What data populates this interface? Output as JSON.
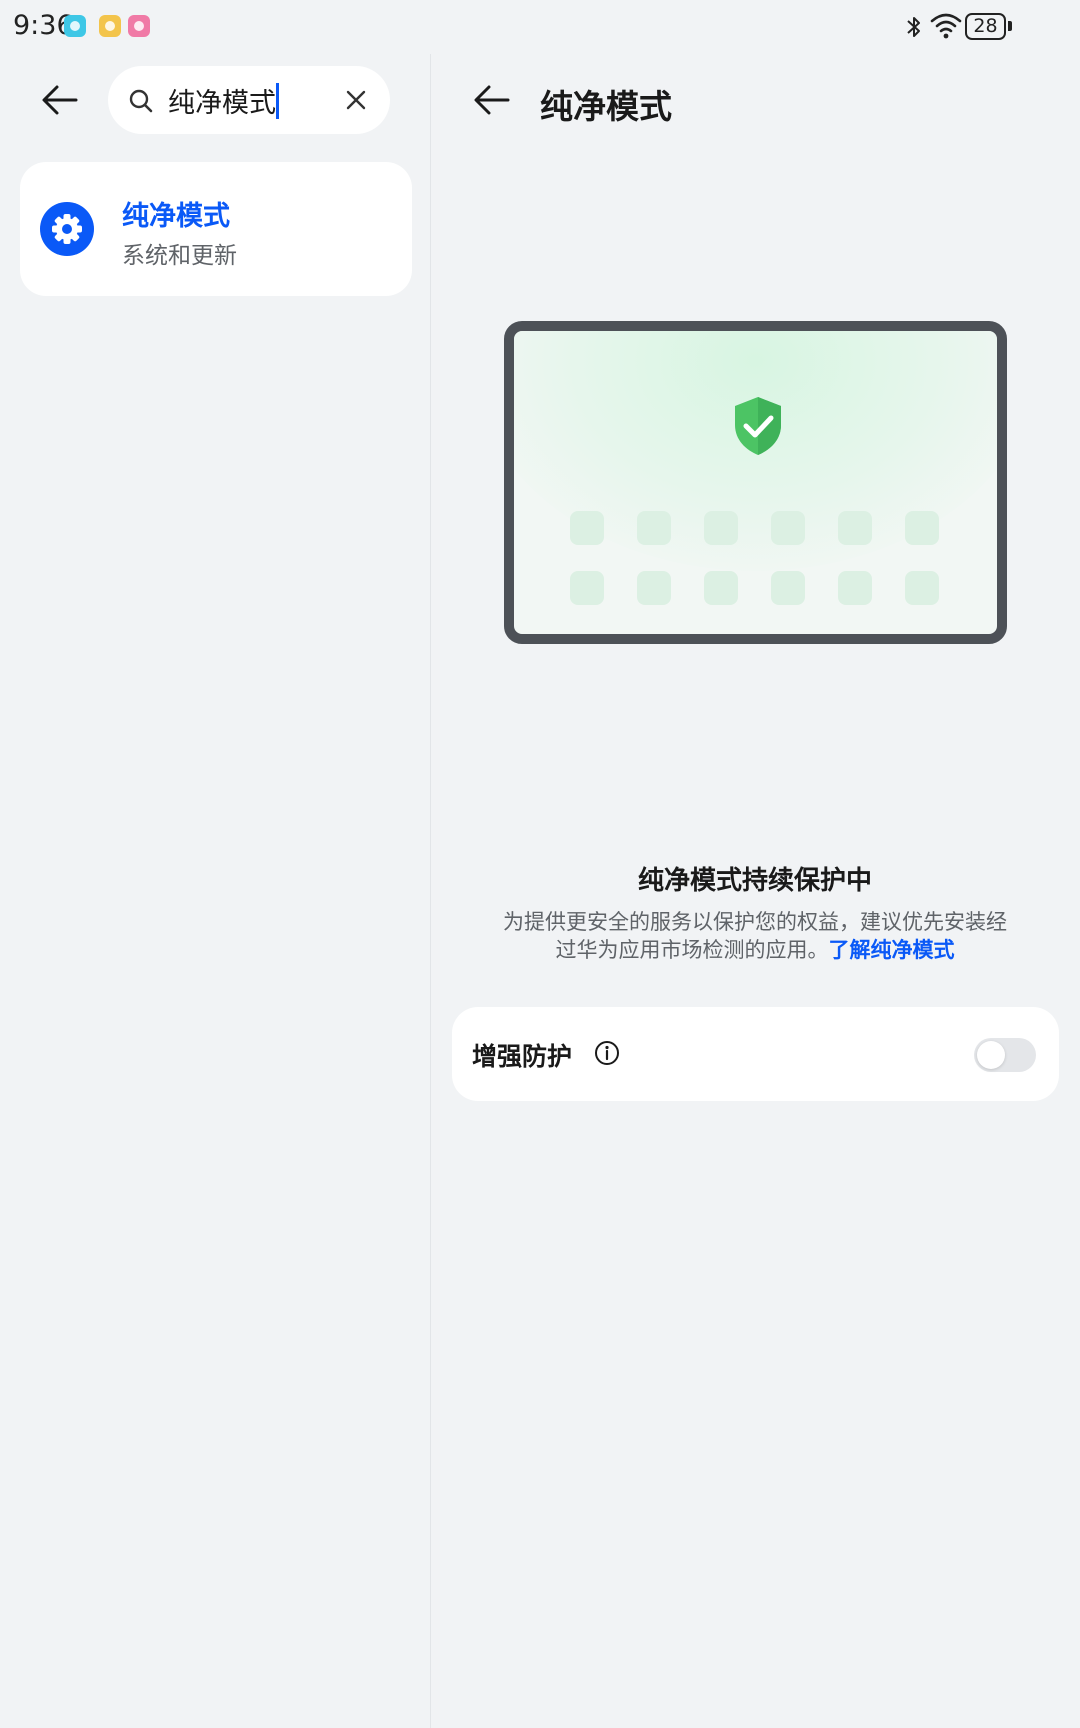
{
  "status_bar": {
    "time": "9:36",
    "battery": "28",
    "notification_icons": [
      {
        "name": "camera-notification-icon",
        "color": "#3ec7e6"
      },
      {
        "name": "gallery-notification-icon",
        "color": "#f3c44b"
      },
      {
        "name": "photo-notification-icon",
        "color": "#f07aa6"
      }
    ],
    "icons": [
      "bluetooth-icon",
      "wifi-icon",
      "battery-icon"
    ]
  },
  "search": {
    "query": "纯净模式",
    "icon": "search-icon",
    "clear_icon": "close-icon"
  },
  "results": [
    {
      "title": "纯净模式",
      "subtitle": "系统和更新",
      "icon": "settings-gear-icon"
    }
  ],
  "detail": {
    "title": "纯净模式",
    "illustration": "tablet-shield-illustration",
    "heading": "纯净模式持续保护中",
    "description_line1": "为提供更安全的服务以保护您的权益，建议优先安装经",
    "description_line2": "过华为应用市场检测的应用。",
    "learn_more": "了解纯净模式",
    "enhanced_protection_label": "增强防护",
    "enhanced_protection_on": false
  },
  "colors": {
    "accent": "#0a59f7",
    "background": "#f1f3f5",
    "card": "#ffffff",
    "shield_green": "#4cc464"
  }
}
